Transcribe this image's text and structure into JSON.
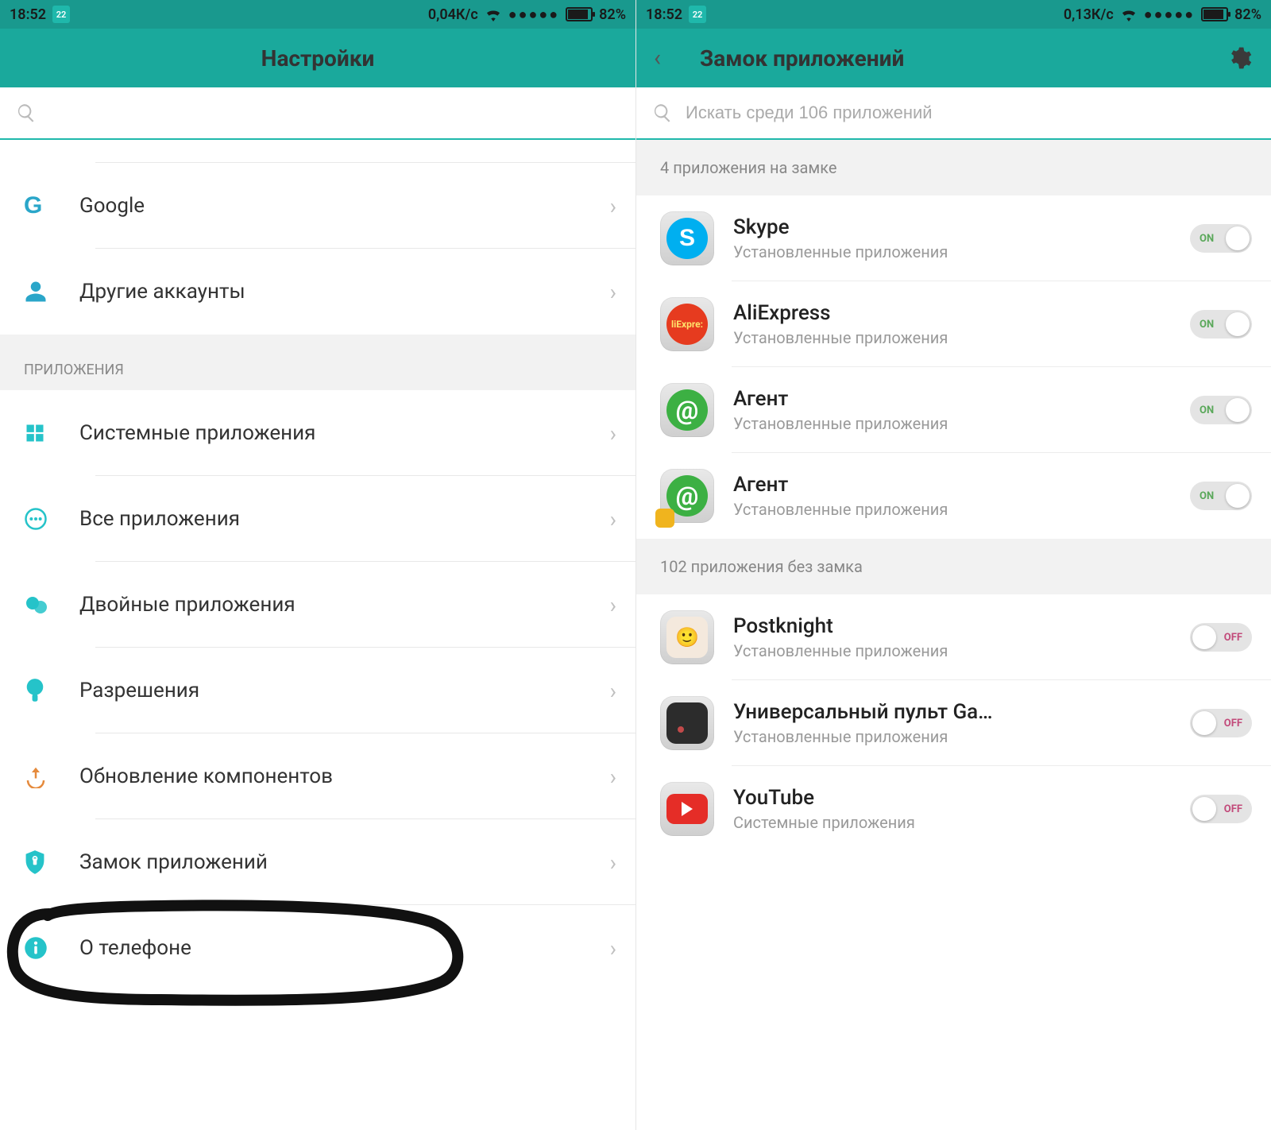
{
  "left": {
    "status": {
      "time": "18:52",
      "date_badge": "22",
      "speed": "0,04К/с",
      "battery": "82%"
    },
    "header": {
      "title": "Настройки"
    },
    "search": {
      "placeholder": ""
    },
    "rows": {
      "google": "Google",
      "other_accounts": "Другие аккаунты"
    },
    "section_apps": "ПРИЛОЖЕНИЯ",
    "rows2": {
      "system_apps": "Системные приложения",
      "all_apps": "Все приложения",
      "dual_apps": "Двойные приложения",
      "permissions": "Разрешения",
      "component_update": "Обновление компонентов",
      "app_lock": "Замок приложений",
      "about_phone": "О телефоне"
    }
  },
  "right": {
    "status": {
      "time": "18:52",
      "date_badge": "22",
      "speed": "0,13К/с",
      "battery": "82%"
    },
    "header": {
      "title": "Замок приложений"
    },
    "search": {
      "placeholder": "Искать среди 106 приложений"
    },
    "locked_header": "4 приложения на замке",
    "unlocked_header": "102 приложения без замка",
    "sub_installed": "Установленные приложения",
    "sub_system": "Системные приложения",
    "toggle_on": "ON",
    "toggle_off": "OFF",
    "apps_locked": [
      {
        "name": "Skype"
      },
      {
        "name": "AliExpress"
      },
      {
        "name": "Агент"
      },
      {
        "name": "Агент"
      }
    ],
    "apps_unlocked": [
      {
        "name": "Postknight"
      },
      {
        "name": "Универсальный пульт Ga…"
      },
      {
        "name": "YouTube"
      }
    ]
  }
}
